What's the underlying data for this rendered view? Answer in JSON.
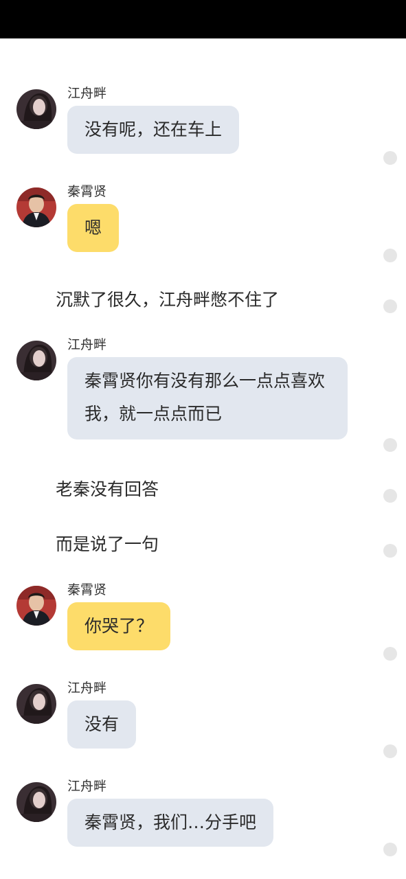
{
  "characters": {
    "jiang": "江舟畔",
    "qin": "秦霄贤"
  },
  "messages": [
    {
      "kind": "bubble",
      "sender": "江舟畔",
      "text": "没有呢，还在车上"
    },
    {
      "kind": "bubble",
      "sender": "秦霄贤",
      "text": "嗯"
    },
    {
      "kind": "narration",
      "text": "沉默了很久，江舟畔憋不住了"
    },
    {
      "kind": "bubble",
      "sender": "江舟畔",
      "text": "秦霄贤你有没有那么一点点喜欢我，就一点点而已"
    },
    {
      "kind": "narration",
      "text": "老秦没有回答"
    },
    {
      "kind": "narration",
      "text": "而是说了一句"
    },
    {
      "kind": "bubble",
      "sender": "秦霄贤",
      "text": "你哭了？"
    },
    {
      "kind": "bubble",
      "sender": "江舟畔",
      "text": "没有"
    },
    {
      "kind": "bubble",
      "sender": "江舟畔",
      "text": "秦霄贤，我们…分手吧"
    }
  ],
  "colors": {
    "jiang_bubble": "#e2e7ef",
    "qin_bubble": "#fddc6a",
    "status_bar": "#000000",
    "read_dot": "#e6e6e6"
  },
  "icons": {
    "jiang_avatar": "girl-dark-hair-avatar",
    "qin_avatar": "man-suit-avatar",
    "dot": "read-status-dot"
  }
}
